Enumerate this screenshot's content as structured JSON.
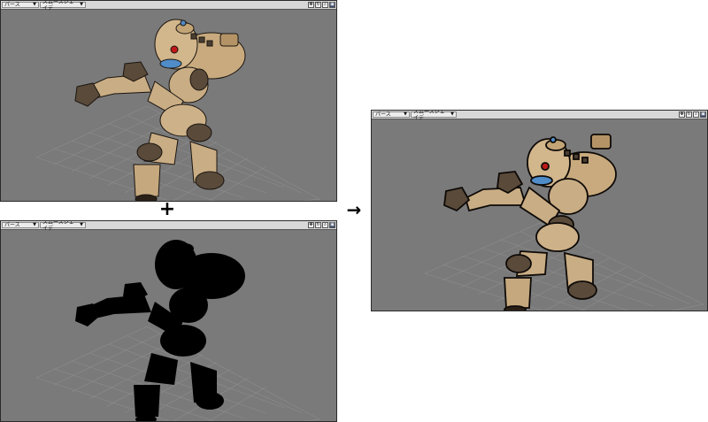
{
  "viewports": [
    {
      "view_mode": "パース",
      "shading_mode": "スムースシェイデ",
      "render": "shaded"
    },
    {
      "view_mode": "パース",
      "shading_mode": "スムースシェイデ",
      "render": "silhouette"
    },
    {
      "view_mode": "パース",
      "shading_mode": "スムースシェイデ",
      "render": "shaded"
    }
  ],
  "header_icons": [
    "move-icon",
    "rotate-icon",
    "zoom-icon",
    "maximize-icon"
  ],
  "operators": {
    "plus": "+",
    "arrow": "→"
  },
  "colors": {
    "viewport_bg": "#7a7a7a",
    "grid": "#8c8c8c",
    "body_tan": "#c9ad84",
    "joint_dark": "#5a4a3a",
    "eye_red": "#c01818",
    "visor_blue": "#4f8cc8",
    "silhouette": "#000000"
  }
}
